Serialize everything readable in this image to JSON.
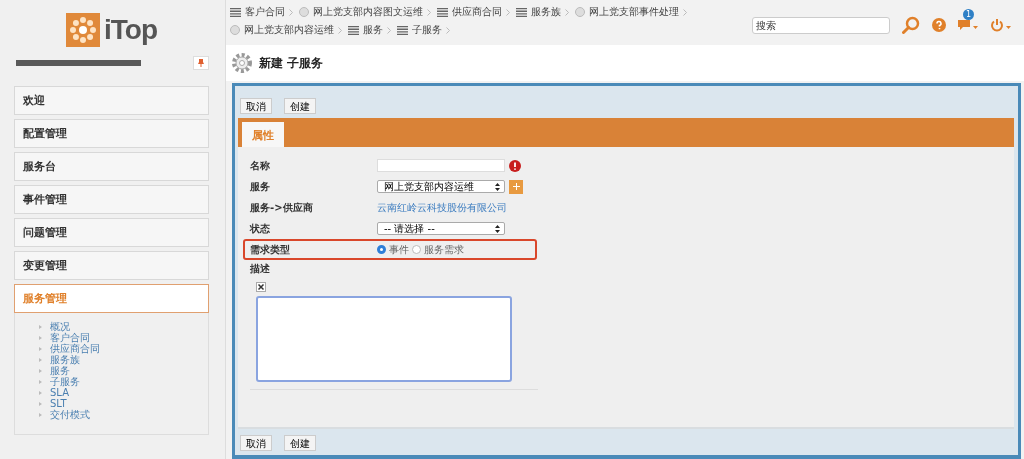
{
  "logo": {
    "text": "iTop"
  },
  "sidebar": {
    "menu": [
      {
        "label": "欢迎",
        "selected": false
      },
      {
        "label": "配置管理",
        "selected": false
      },
      {
        "label": "服务台",
        "selected": false
      },
      {
        "label": "事件管理",
        "selected": false
      },
      {
        "label": "问题管理",
        "selected": false
      },
      {
        "label": "变更管理",
        "selected": false
      },
      {
        "label": "服务管理",
        "selected": true
      }
    ],
    "submenu": [
      "概况",
      "客户合同",
      "供应商合同",
      "服务族",
      "服务",
      "子服务",
      "SLA",
      "SLT",
      "交付模式"
    ]
  },
  "breadcrumbs": [
    [
      {
        "label": "客户合同",
        "kind": "list"
      },
      {
        "label": "网上党支部内容图文运维",
        "kind": "object"
      },
      {
        "label": "供应商合同",
        "kind": "list"
      },
      {
        "label": "服务族",
        "kind": "list"
      },
      {
        "label": "网上党支部事件处理",
        "kind": "object"
      }
    ],
    [
      {
        "label": "网上党支部内容运维",
        "kind": "object"
      },
      {
        "label": "服务",
        "kind": "list"
      },
      {
        "label": "子服务",
        "kind": "list"
      }
    ]
  ],
  "search": {
    "placeholder": "搜索"
  },
  "notifications": {
    "count": "1"
  },
  "page_title": "新建 子服务",
  "top_buttons": [
    "取消",
    "创建"
  ],
  "bottom_buttons": [
    "取消",
    "创建"
  ],
  "tab": "属性",
  "fields": [
    {
      "label": "名称",
      "kind": "input",
      "error": true
    },
    {
      "label": "服务",
      "kind": "select",
      "value": "网上党支部内容运维",
      "add": true
    },
    {
      "label": "服务->供应商",
      "kind": "link",
      "value": "云南红岭云科技股份有限公司"
    },
    {
      "label": "状态",
      "kind": "select",
      "value": "-- 请选择 --"
    },
    {
      "label": "需求类型",
      "kind": "radio",
      "highlighted": true,
      "options": [
        {
          "label": "事件",
          "selected": true
        },
        {
          "label": "服务需求",
          "selected": false
        }
      ]
    },
    {
      "label": "描述",
      "kind": "textarea"
    }
  ]
}
